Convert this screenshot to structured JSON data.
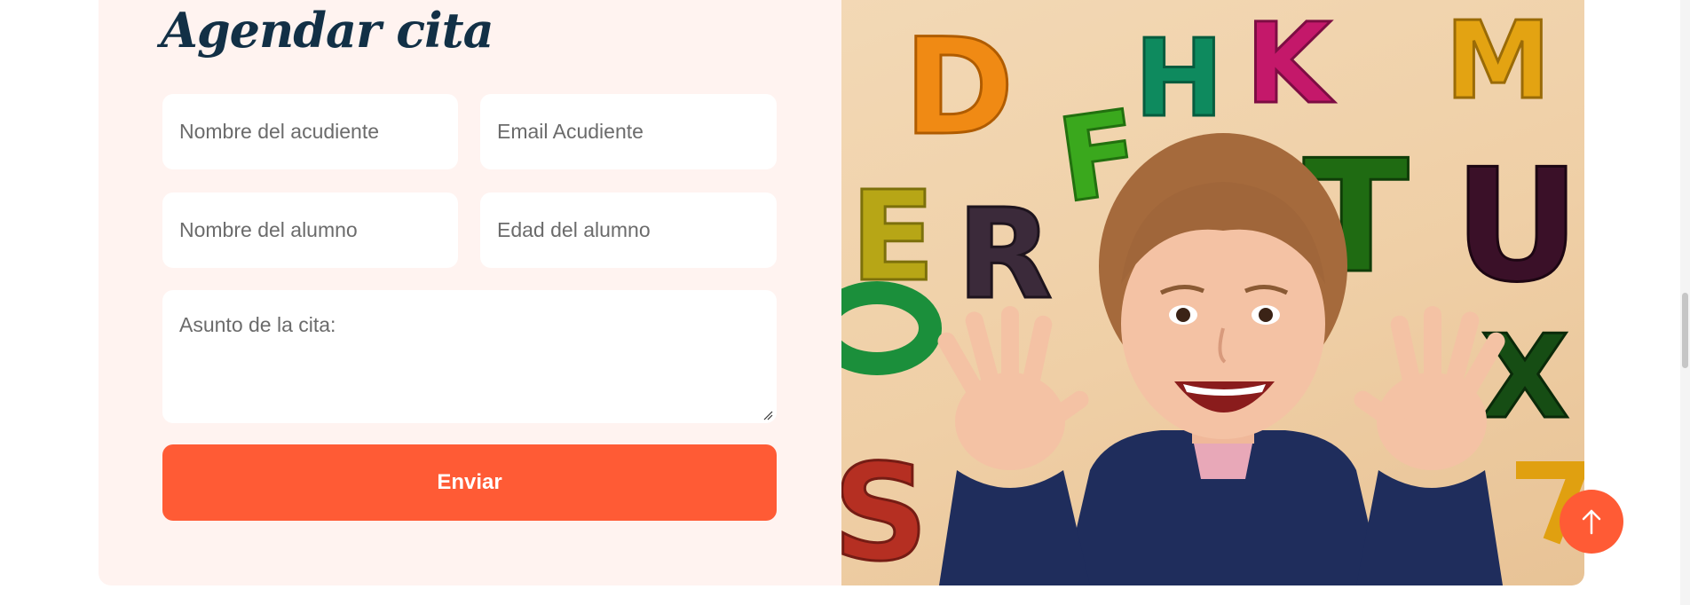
{
  "form": {
    "title": "Agendar cita",
    "guardian_name_placeholder": "Nombre del acudiente",
    "guardian_email_placeholder": "Email Acudiente",
    "student_name_placeholder": "Nombre del alumno",
    "student_age_placeholder": "Edad del alumno",
    "subject_placeholder": "Asunto de la cita:",
    "submit_label": "Enviar"
  },
  "image": {
    "letters": [
      "D",
      "H",
      "K",
      "M",
      "F",
      "E",
      "R",
      "T",
      "U",
      "X",
      "S"
    ]
  },
  "colors": {
    "accent": "#ff5b35",
    "form_background": "#fff3f0",
    "title": "#123046",
    "field_text": "#6b6b6b"
  },
  "icons": {
    "back_to_top": "arrow-up-icon",
    "resize": "resize-handle-icon"
  }
}
